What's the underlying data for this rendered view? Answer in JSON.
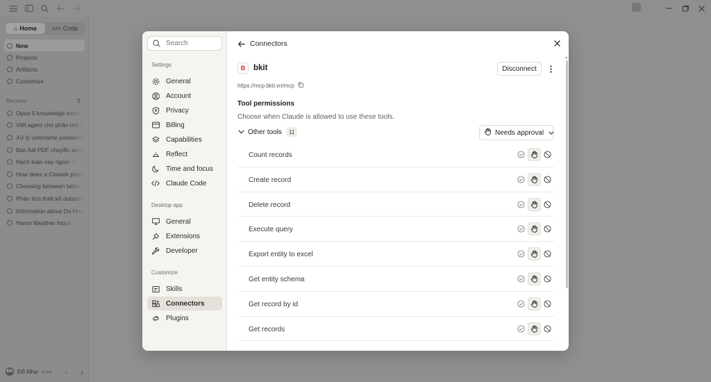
{
  "app": {
    "mode_tabs": [
      {
        "label": "Home",
        "active": true
      },
      {
        "label": "Code",
        "active": false
      }
    ],
    "nav": [
      {
        "label": "New",
        "icon": "plus-icon",
        "active": true
      },
      {
        "label": "Projects",
        "icon": "folder-icon"
      },
      {
        "label": "Artifacts",
        "icon": "artifact-icon"
      },
      {
        "label": "Customize",
        "icon": "customize-icon"
      }
    ],
    "recents_label": "Recents",
    "recents": [
      "Opus 5 knowledge cutoff",
      "Viết agent cho phần mềm",
      "Xử lý username password",
      "Bản full PDF chuyển sang",
      "Hạch toán vay ngoại tệ",
      "How does a Cowork project",
      "Choosing between tables",
      "Phân tích thiết kế database",
      "Information about Do Hoang",
      "Hanoi Weather Inquiry"
    ],
    "user": {
      "name": "Đỗ Như",
      "initials": "ĐN",
      "plan": "Free"
    }
  },
  "settings": {
    "search_placeholder": "Search",
    "sections": {
      "settings": "Settings",
      "desktop": "Desktop app",
      "customize": "Customize"
    },
    "settings_items": [
      {
        "label": "General",
        "icon": "gear-icon"
      },
      {
        "label": "Account",
        "icon": "account-icon"
      },
      {
        "label": "Privacy",
        "icon": "shield-icon"
      },
      {
        "label": "Billing",
        "icon": "card-icon"
      },
      {
        "label": "Capabilities",
        "icon": "layers-icon"
      },
      {
        "label": "Reflect",
        "icon": "reflect-icon"
      },
      {
        "label": "Time and focus",
        "icon": "clock-icon"
      },
      {
        "label": "Claude Code",
        "icon": "code-icon"
      }
    ],
    "desktop_items": [
      {
        "label": "General",
        "icon": "monitor-icon"
      },
      {
        "label": "Extensions",
        "icon": "extensions-icon"
      },
      {
        "label": "Developer",
        "icon": "wrench-icon"
      }
    ],
    "customize_items": [
      {
        "label": "Skills",
        "icon": "skills-icon"
      },
      {
        "label": "Connectors",
        "icon": "connectors-icon",
        "active": true
      },
      {
        "label": "Plugins",
        "icon": "plugin-icon"
      }
    ]
  },
  "connector": {
    "header_title": "Connectors",
    "logo_letter": "B",
    "logo_color": "#d92b2b",
    "name": "bkit",
    "disconnect_label": "Disconnect",
    "url": "https://mcp.bkit.vn/mcp",
    "permissions_title": "Tool permissions",
    "permissions_subtitle": "Choose when Claude is allowed to use these tools.",
    "group": {
      "label": "Other tools",
      "count": "11",
      "approval_label": "Needs approval"
    },
    "tools": [
      {
        "name": "Count records",
        "mode": "needs-approval"
      },
      {
        "name": "Create record",
        "mode": "needs-approval"
      },
      {
        "name": "Delete record",
        "mode": "needs-approval"
      },
      {
        "name": "Execute query",
        "mode": "needs-approval"
      },
      {
        "name": "Export entity to excel",
        "mode": "needs-approval"
      },
      {
        "name": "Get entity schema",
        "mode": "needs-approval"
      },
      {
        "name": "Get record by id",
        "mode": "needs-approval"
      },
      {
        "name": "Get records",
        "mode": "needs-approval"
      }
    ]
  }
}
